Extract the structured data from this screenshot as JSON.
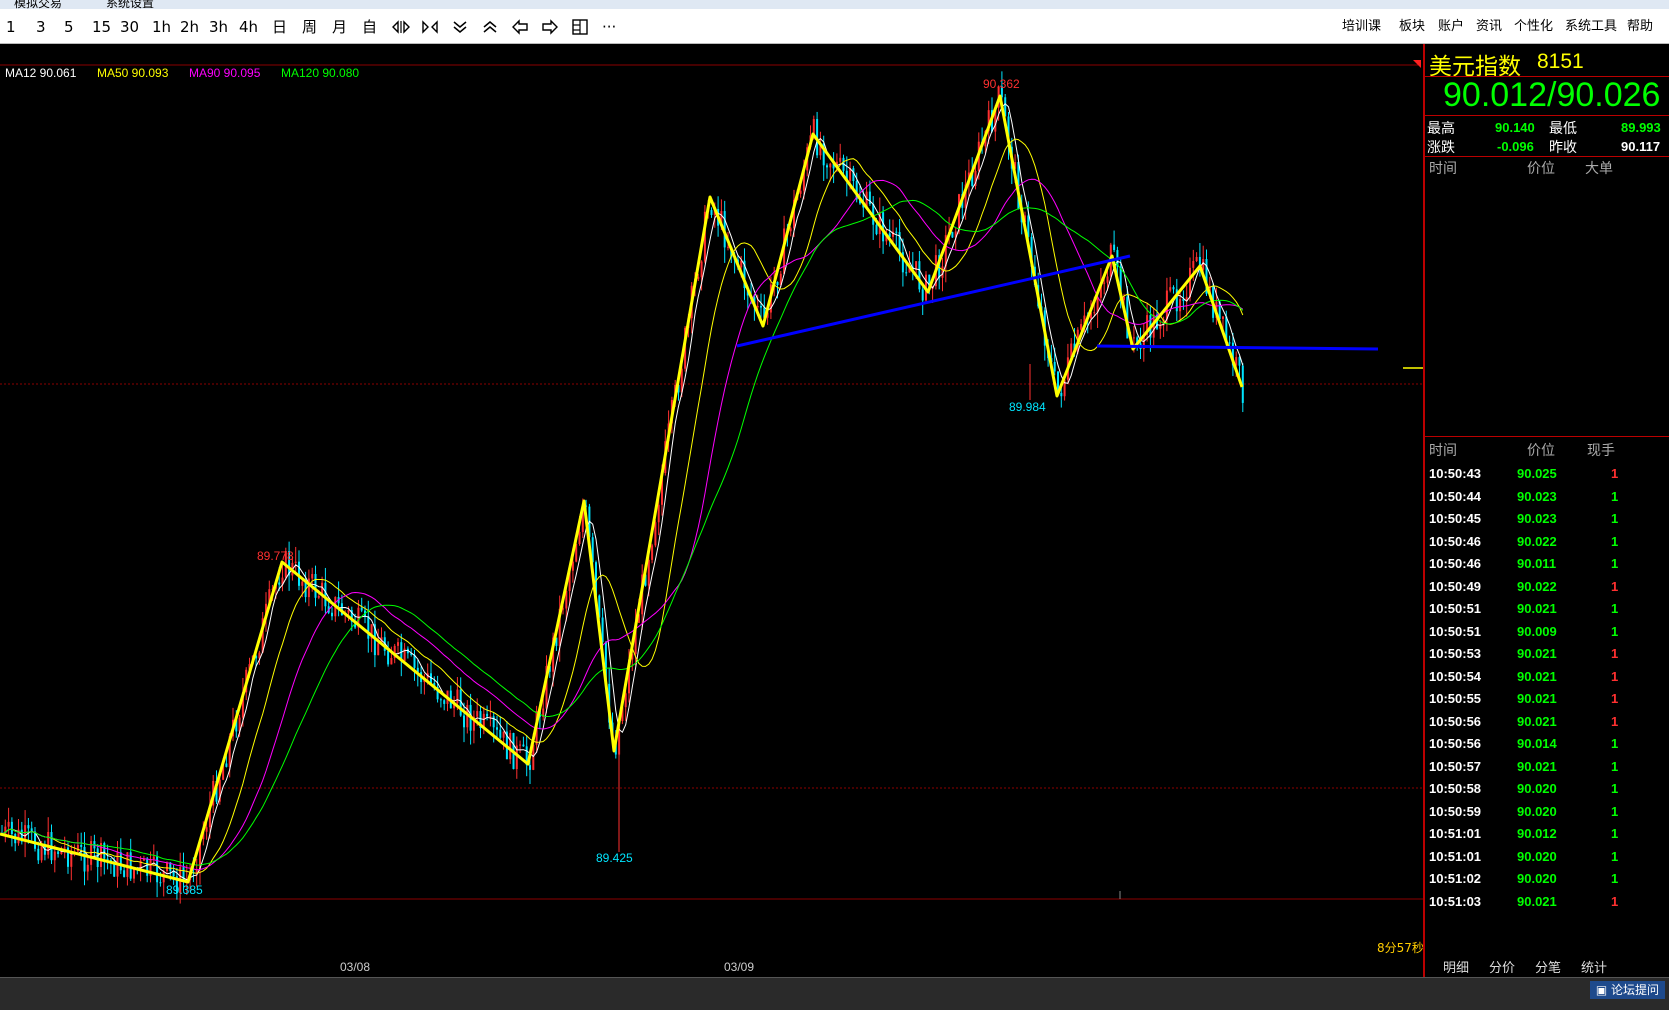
{
  "titlebar": {
    "text1": "模拟交易",
    "text2": "系统设置"
  },
  "toolbar": {
    "periods": [
      "1",
      "3",
      "5",
      "15",
      "30",
      "1h",
      "2h",
      "3h",
      "4h",
      "日",
      "周",
      "月",
      "自"
    ],
    "more": "···",
    "menu": [
      "培训课",
      "板块",
      "账户",
      "资讯",
      "个性化",
      "系统工具",
      "帮助"
    ]
  },
  "chart": {
    "ma_legend": [
      {
        "label": "MA12 90.061",
        "color": "#ffffff"
      },
      {
        "label": "MA50 90.093",
        "color": "#ffff00"
      },
      {
        "label": "MA90 90.095",
        "color": "#ff00ff"
      },
      {
        "label": "MA120 90.080",
        "color": "#00ff00"
      }
    ],
    "price_labels": [
      {
        "text": "90.362",
        "color": "#ff3030"
      },
      {
        "text": "89.778",
        "color": "#ff3030"
      },
      {
        "text": "89.984",
        "color": "#00e5ff"
      },
      {
        "text": "89.425",
        "color": "#00e5ff"
      },
      {
        "text": "89.385",
        "color": "#00e5ff"
      }
    ],
    "dates": [
      "03/08",
      "03/09"
    ],
    "countdown": "8分57秒"
  },
  "chart_data": {
    "type": "line",
    "title": "",
    "xlabel": "",
    "ylabel": "",
    "x": [
      "03/08",
      "03/09"
    ],
    "series": [
      {
        "name": "MA12",
        "color": "#ffffff",
        "values": []
      },
      {
        "name": "MA50",
        "color": "#ffff00",
        "values": []
      },
      {
        "name": "MA90",
        "color": "#ff00ff",
        "values": []
      },
      {
        "name": "MA120",
        "color": "#00ff00",
        "values": []
      }
    ],
    "annotations": [
      "90.362",
      "89.778",
      "89.984",
      "89.425",
      "89.385"
    ],
    "ylim": [
      89.38,
      90.37
    ],
    "grid": false
  },
  "sidebar": {
    "name": "美元指数",
    "code": "8151",
    "quote": "90.012/90.026",
    "high_label": "最高",
    "high": "90.140",
    "low_label": "最低",
    "low": "89.993",
    "change_label": "涨跌",
    "change": "-0.096",
    "prev_label": "昨收",
    "prev": "90.117",
    "upper_headers": [
      "时间",
      "价位",
      "大单"
    ],
    "lower_headers": [
      "时间",
      "价位",
      "现手"
    ],
    "ticks": [
      {
        "time": "10:50:43",
        "price": "90.025",
        "vol": "1",
        "vc": "#ff3030"
      },
      {
        "time": "10:50:44",
        "price": "90.023",
        "vol": "1",
        "vc": "#00ff00"
      },
      {
        "time": "10:50:45",
        "price": "90.023",
        "vol": "1",
        "vc": "#00ff00"
      },
      {
        "time": "10:50:46",
        "price": "90.022",
        "vol": "1",
        "vc": "#00ff00"
      },
      {
        "time": "10:50:46",
        "price": "90.011",
        "vol": "1",
        "vc": "#00ff00"
      },
      {
        "time": "10:50:49",
        "price": "90.022",
        "vol": "1",
        "vc": "#ff3030"
      },
      {
        "time": "10:50:51",
        "price": "90.021",
        "vol": "1",
        "vc": "#00ff00"
      },
      {
        "time": "10:50:51",
        "price": "90.009",
        "vol": "1",
        "vc": "#00ff00"
      },
      {
        "time": "10:50:53",
        "price": "90.021",
        "vol": "1",
        "vc": "#ff3030"
      },
      {
        "time": "10:50:54",
        "price": "90.021",
        "vol": "1",
        "vc": "#ff3030"
      },
      {
        "time": "10:50:55",
        "price": "90.021",
        "vol": "1",
        "vc": "#ff3030"
      },
      {
        "time": "10:50:56",
        "price": "90.021",
        "vol": "1",
        "vc": "#ff3030"
      },
      {
        "time": "10:50:56",
        "price": "90.014",
        "vol": "1",
        "vc": "#00ff00"
      },
      {
        "time": "10:50:57",
        "price": "90.021",
        "vol": "1",
        "vc": "#00ff00"
      },
      {
        "time": "10:50:58",
        "price": "90.020",
        "vol": "1",
        "vc": "#00ff00"
      },
      {
        "time": "10:50:59",
        "price": "90.020",
        "vol": "1",
        "vc": "#00ff00"
      },
      {
        "time": "10:51:01",
        "price": "90.012",
        "vol": "1",
        "vc": "#00ff00"
      },
      {
        "time": "10:51:01",
        "price": "90.020",
        "vol": "1",
        "vc": "#00ff00"
      },
      {
        "time": "10:51:02",
        "price": "90.020",
        "vol": "1",
        "vc": "#00ff00"
      },
      {
        "time": "10:51:03",
        "price": "90.021",
        "vol": "1",
        "vc": "#ff3030"
      }
    ],
    "tabs": [
      "明细",
      "分价",
      "分笔",
      "统计"
    ]
  },
  "status": {
    "forum": "论坛提问"
  },
  "colors": {
    "bull": "#ff3030",
    "bear": "#00e5ff",
    "zigzag": "#ffff00",
    "trendline": "#0000ff",
    "price_green": "#00ff00",
    "frame_red": "#bb0000"
  }
}
